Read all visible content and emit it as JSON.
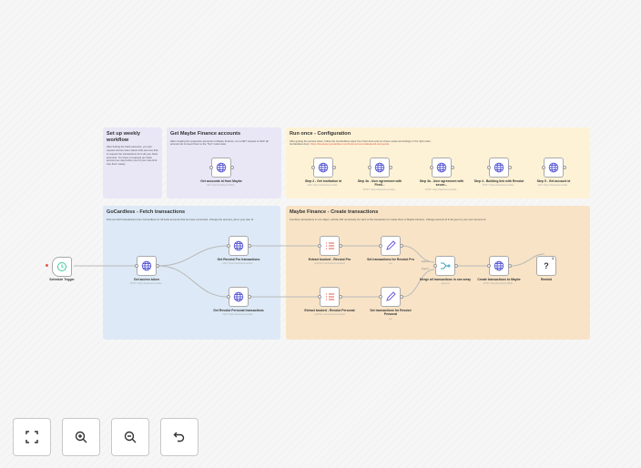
{
  "stickies": [
    {
      "title": "Set up weekly workflow",
      "text": "After finding the bank accounts, you can request access token (lasts 24h) and use that to request the transactions from all your bank accounts. You have 4 requests per bank account per day before you hit your rate limit. Use them wisely."
    },
    {
      "title": "Get Maybe Finance accounts",
      "text": "After creating the respective accounts in Maybe Finance, run a GET request to fetch all account ids to insert them to the \"Set\" nodes later."
    },
    {
      "title": "Run once - Configuration",
      "text": "After getting the access token, follow the GoCardless steps from their docs and run these nodes accordingly in the right order.",
      "docs_prefix": "GoCardless docs:",
      "docs_link": "https://developer.gocardless.com/bank-account-data/quick-start-guide"
    },
    {
      "title": "GoCardless - Fetch transactions",
      "text": "First we fetch transactions from GoCardless for all bank accounts that we have connected. Change the account_ids to your own id."
    },
    {
      "title": "Maybe Finance - Create transactions",
      "text": "Combine transactions in one object, call the API recursively for each of the transaction to create them to Maybe Finance. Change account id in the json to your own account id."
    }
  ],
  "nodes": {
    "schedule": {
      "label": "Schedule Trigger"
    },
    "maybe_accounts": {
      "label": "Get accounts id from Maybe",
      "sub": "GET: http://localhost:3000/..."
    },
    "step2": {
      "label": "Step 2 - Get institution id",
      "sub": "GET: https://bankaccountdat..."
    },
    "step3a": {
      "label": "Step 3a - User agreement with Firstl...",
      "sub": "POST: https://bankaccountdat..."
    },
    "step3b": {
      "label": "Step 3a - User agreement with secon...",
      "sub": "POST: https://bankaccountdat..."
    },
    "step4": {
      "label": "Step 4 - Building link with Revolut",
      "sub": "POST: https://bankaccountdat..."
    },
    "step5": {
      "label": "Step 5 - Get account id",
      "sub": "GET: https://bankaccountdat..."
    },
    "token": {
      "label": "Get access token",
      "sub": "POST: https://bankaccountdat..."
    },
    "revpro": {
      "label": "Get Revolut Pro transactions",
      "sub": "GET: https://bankaccountdat..."
    },
    "revpers": {
      "label": "Get Revolut Personal transactions",
      "sub": "GET: https://bankaccountdat..."
    },
    "extpro": {
      "label": "Extract booked - Revolut Pro",
      "sub": "splitOut: transactions.booked"
    },
    "extpers": {
      "label": "Extract booked - Revolut Personal",
      "sub": "splitOut: transactions.booked"
    },
    "setpro": {
      "label": "Set transactions for Revolut Pro",
      "sub": "set"
    },
    "setpers": {
      "label": "Set transactions for Revolut Personal",
      "sub": "set"
    },
    "merge": {
      "label": "Merge all transactions in one array",
      "sub": "append",
      "in1": "input 1",
      "in2": "input 2"
    },
    "create": {
      "label": "Create transactions to Maybe",
      "sub": "POST: http://localhost:3000/..."
    },
    "rewind": {
      "label": "Rewind",
      "badge": "1",
      "glyph": "?"
    }
  },
  "controls": [
    {
      "name": "fit-view",
      "icon": "fullscreen-icon"
    },
    {
      "name": "zoom-in",
      "icon": "zoom-in-icon"
    },
    {
      "name": "zoom-out",
      "icon": "zoom-out-icon"
    },
    {
      "name": "undo",
      "icon": "undo-icon"
    }
  ],
  "colors": {
    "sticky_purple": "#e9e6f6",
    "sticky_yellow": "#fdf2d5",
    "sticky_blue": "#dde9f6",
    "sticky_orange": "#f8e3c6",
    "http_icon": "#5b5bd6",
    "split_icon": "#e8584a",
    "set_icon": "#6d5bd6",
    "merge_icon": "#35a7bd",
    "trigger_icon": "#3ec99a"
  }
}
